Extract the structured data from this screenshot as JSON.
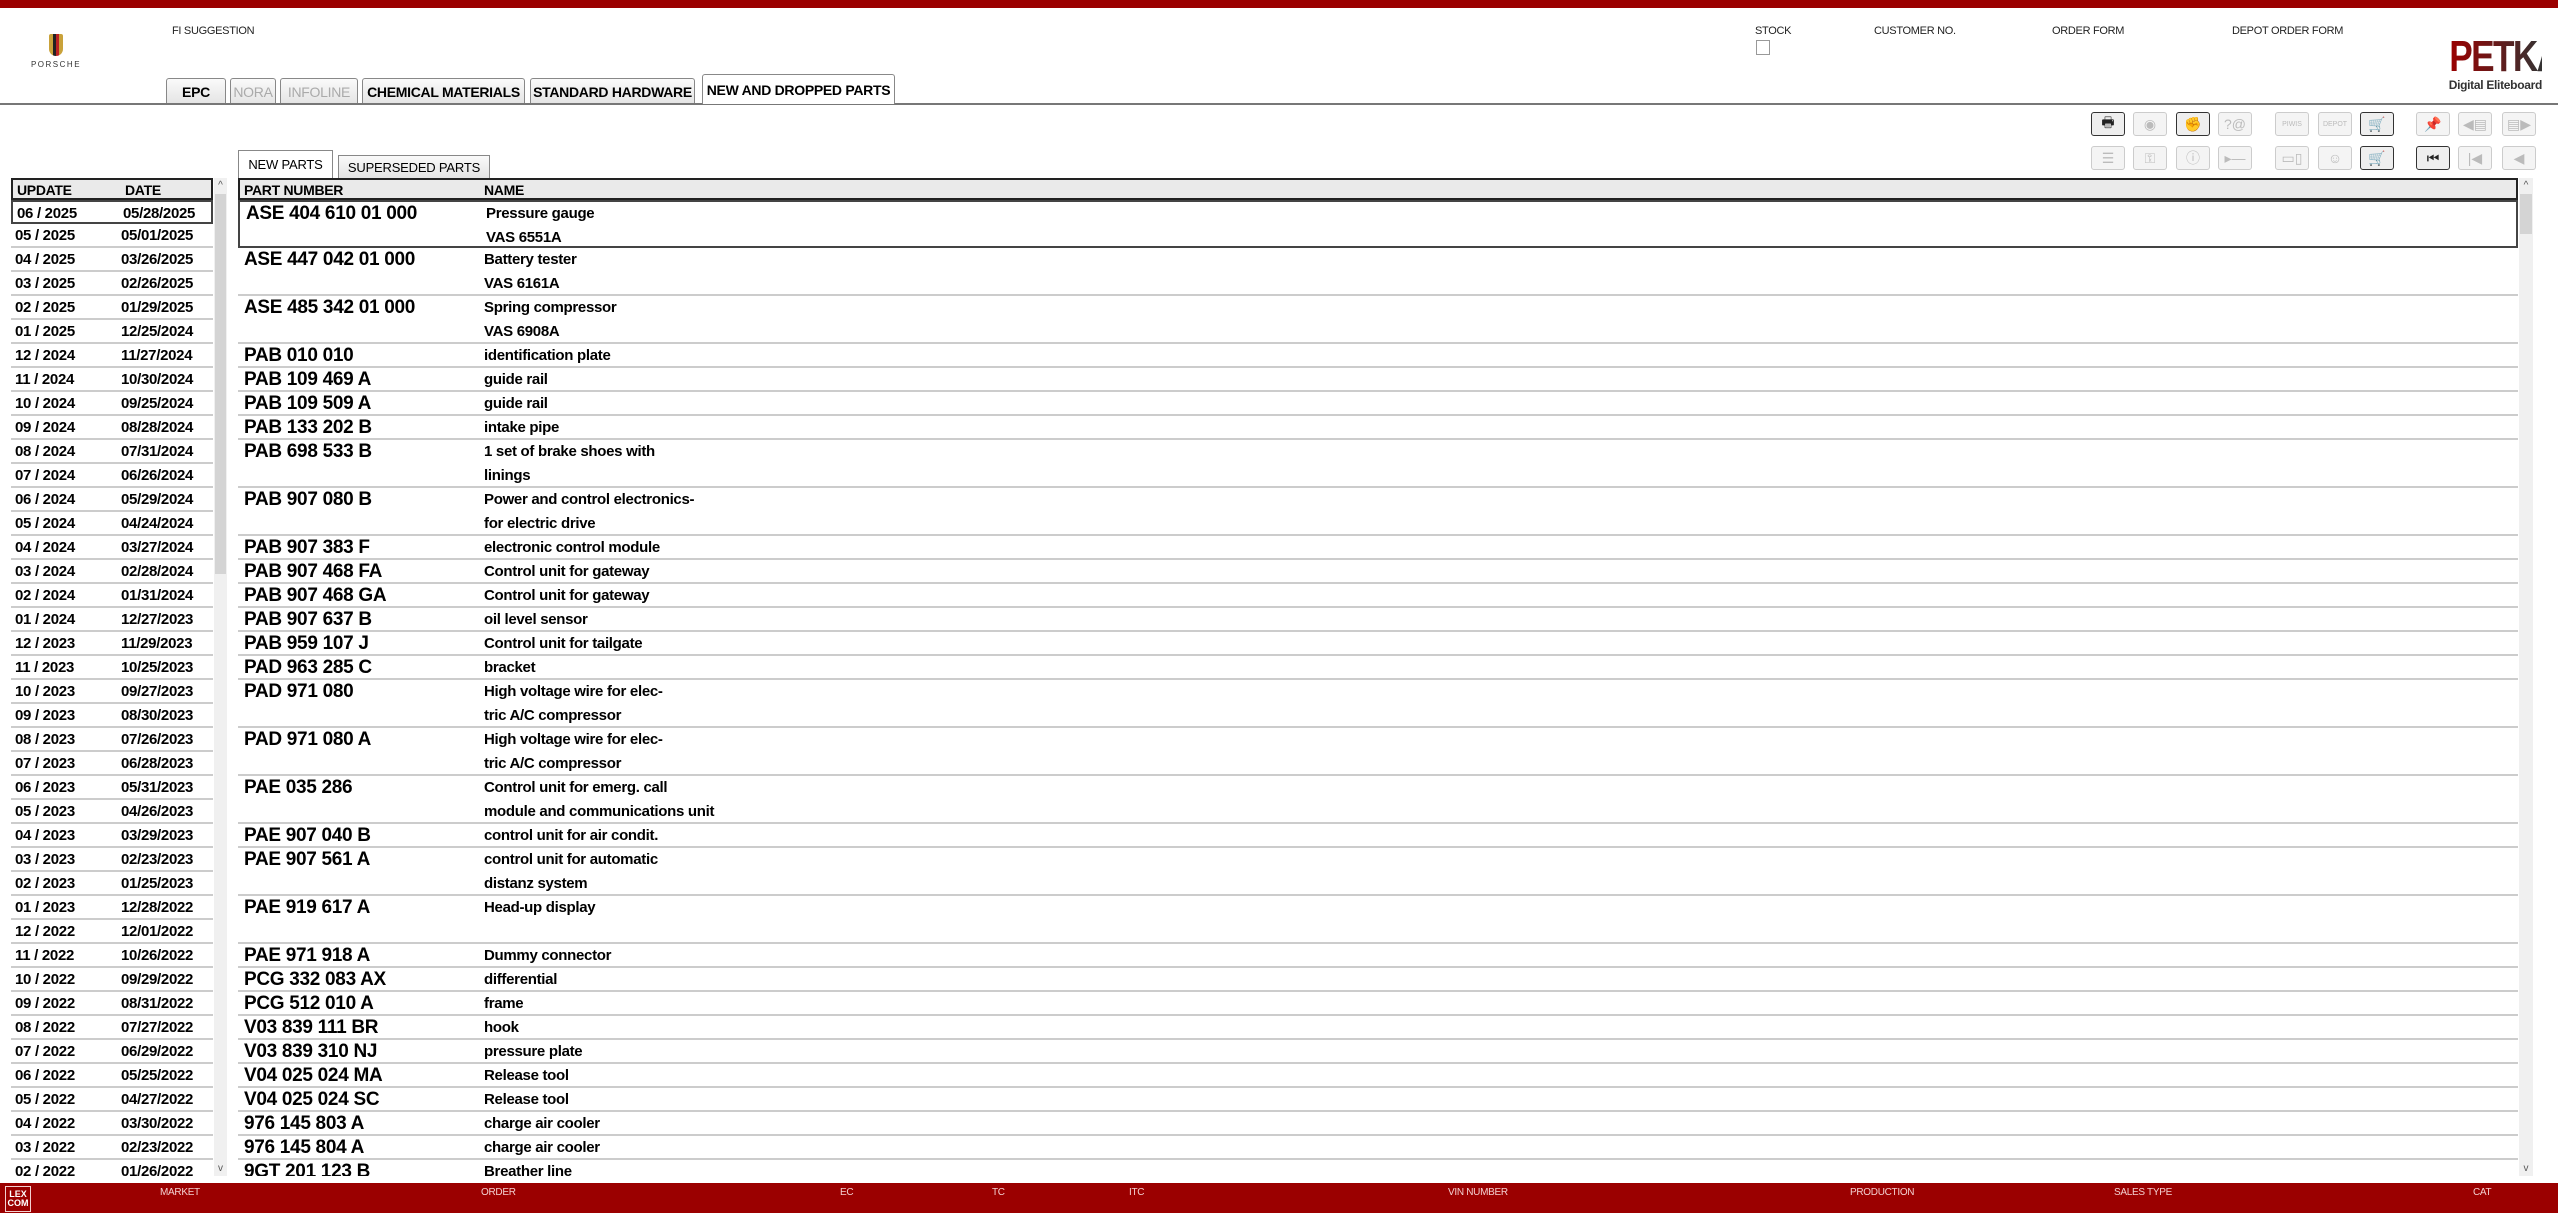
{
  "header": {
    "fi_suggestion": "FI SUGGESTION",
    "stock": "STOCK",
    "customer_no": "CUSTOMER NO.",
    "order_form": "ORDER FORM",
    "depot_order_form": "DEPOT ORDER FORM",
    "porsche_logo": "PORSCHE",
    "petka_logo": "PETKA",
    "petka_sub": "Digital Eliteboard"
  },
  "tabs": [
    "EPC",
    "NORA",
    "INFOLINE",
    "CHEMICAL MATERIALS",
    "STANDARD HARDWARE",
    "NEW AND DROPPED PARTS"
  ],
  "subtabs": [
    "NEW PARTS",
    "SUPERSEDED PARTS"
  ],
  "toolbar": {
    "piwis": "PIWIS",
    "depot": "DEPOT"
  },
  "left_list": {
    "headers": [
      "UPDATE",
      "DATE"
    ],
    "rows": [
      [
        "06 / 2025",
        "05/28/2025"
      ],
      [
        "05 / 2025",
        "05/01/2025"
      ],
      [
        "04 / 2025",
        "03/26/2025"
      ],
      [
        "03 / 2025",
        "02/26/2025"
      ],
      [
        "02 / 2025",
        "01/29/2025"
      ],
      [
        "01 / 2025",
        "12/25/2024"
      ],
      [
        "12 / 2024",
        "11/27/2024"
      ],
      [
        "11 / 2024",
        "10/30/2024"
      ],
      [
        "10 / 2024",
        "09/25/2024"
      ],
      [
        "09 / 2024",
        "08/28/2024"
      ],
      [
        "08 / 2024",
        "07/31/2024"
      ],
      [
        "07 / 2024",
        "06/26/2024"
      ],
      [
        "06 / 2024",
        "05/29/2024"
      ],
      [
        "05 / 2024",
        "04/24/2024"
      ],
      [
        "04 / 2024",
        "03/27/2024"
      ],
      [
        "03 / 2024",
        "02/28/2024"
      ],
      [
        "02 / 2024",
        "01/31/2024"
      ],
      [
        "01 / 2024",
        "12/27/2023"
      ],
      [
        "12 / 2023",
        "11/29/2023"
      ],
      [
        "11 / 2023",
        "10/25/2023"
      ],
      [
        "10 / 2023",
        "09/27/2023"
      ],
      [
        "09 / 2023",
        "08/30/2023"
      ],
      [
        "08 / 2023",
        "07/26/2023"
      ],
      [
        "07 / 2023",
        "06/28/2023"
      ],
      [
        "06 / 2023",
        "05/31/2023"
      ],
      [
        "05 / 2023",
        "04/26/2023"
      ],
      [
        "04 / 2023",
        "03/29/2023"
      ],
      [
        "03 / 2023",
        "02/23/2023"
      ],
      [
        "02 / 2023",
        "01/25/2023"
      ],
      [
        "01 / 2023",
        "12/28/2022"
      ],
      [
        "12 / 2022",
        "12/01/2022"
      ],
      [
        "11 / 2022",
        "10/26/2022"
      ],
      [
        "10 / 2022",
        "09/29/2022"
      ],
      [
        "09 / 2022",
        "08/31/2022"
      ],
      [
        "08 / 2022",
        "07/27/2022"
      ],
      [
        "07 / 2022",
        "06/29/2022"
      ],
      [
        "06 / 2022",
        "05/25/2022"
      ],
      [
        "05 / 2022",
        "04/27/2022"
      ],
      [
        "04 / 2022",
        "03/30/2022"
      ],
      [
        "03 / 2022",
        "02/23/2022"
      ],
      [
        "02 / 2022",
        "01/26/2022"
      ]
    ]
  },
  "parts": {
    "headers": [
      "PART NUMBER",
      "NAME"
    ],
    "rows": [
      {
        "pn": "ASE 404 610 01 000",
        "name": [
          "Pressure gauge",
          "VAS 6551A"
        ]
      },
      {
        "pn": "ASE 447 042 01 000",
        "name": [
          "Battery tester",
          "VAS 6161A"
        ]
      },
      {
        "pn": "ASE 485 342 01 000",
        "name": [
          "Spring compressor",
          "VAS 6908A"
        ]
      },
      {
        "pn": "PAB 010 010",
        "name": [
          "identification plate"
        ]
      },
      {
        "pn": "PAB 109 469 A",
        "name": [
          "guide rail"
        ]
      },
      {
        "pn": "PAB 109 509 A",
        "name": [
          "guide rail"
        ]
      },
      {
        "pn": "PAB 133 202 B",
        "name": [
          "intake pipe"
        ]
      },
      {
        "pn": "PAB 698 533 B",
        "name": [
          "1 set of brake shoes with",
          "linings"
        ]
      },
      {
        "pn": "PAB 907 080 B",
        "name": [
          "Power and control electronics-",
          "for electric drive"
        ]
      },
      {
        "pn": "PAB 907 383 F",
        "name": [
          "electronic control module"
        ]
      },
      {
        "pn": "PAB 907 468 FA",
        "name": [
          "Control unit for gateway"
        ]
      },
      {
        "pn": "PAB 907 468 GA",
        "name": [
          "Control unit for gateway"
        ]
      },
      {
        "pn": "PAB 907 637 B",
        "name": [
          "oil level sensor"
        ]
      },
      {
        "pn": "PAB 959 107 J",
        "name": [
          "Control unit for tailgate"
        ]
      },
      {
        "pn": "PAD 963 285 C",
        "name": [
          "bracket"
        ]
      },
      {
        "pn": "PAD 971 080",
        "name": [
          "High voltage wire for elec-",
          "tric A/C compressor"
        ]
      },
      {
        "pn": "PAD 971 080 A",
        "name": [
          "High voltage wire for elec-",
          "tric A/C compressor"
        ]
      },
      {
        "pn": "PAE 035 286",
        "name": [
          "Control unit for emerg. call",
          "module and communications unit"
        ]
      },
      {
        "pn": "PAE 907 040 B",
        "name": [
          "control unit for air condit."
        ]
      },
      {
        "pn": "PAE 907 561 A",
        "name": [
          "control unit for automatic",
          "distanz system"
        ]
      },
      {
        "pn": "PAE 919 617 A",
        "name": [
          "Head-up display",
          ""
        ]
      },
      {
        "pn": "PAE 971 918 A",
        "name": [
          "Dummy connector"
        ]
      },
      {
        "pn": "PCG 332 083 AX",
        "name": [
          "differential"
        ]
      },
      {
        "pn": "PCG 512 010 A",
        "name": [
          "frame"
        ]
      },
      {
        "pn": "V03 839 111 BR",
        "name": [
          "hook"
        ]
      },
      {
        "pn": "V03 839 310 NJ",
        "name": [
          "pressure plate"
        ]
      },
      {
        "pn": "V04 025 024 MA",
        "name": [
          "Release tool"
        ]
      },
      {
        "pn": "V04 025 024 SC",
        "name": [
          "Release tool"
        ]
      },
      {
        "pn": "976 145 803 A",
        "name": [
          "charge air cooler"
        ]
      },
      {
        "pn": "976 145 804 A",
        "name": [
          "charge air cooler"
        ]
      },
      {
        "pn": "9GT 201 123 B",
        "name": [
          "Breather line"
        ]
      }
    ]
  },
  "footer": {
    "lexcom": "LEX COM",
    "labels": [
      "MARKET",
      "ORDER",
      "EC",
      "TC",
      "ITC",
      "VIN NUMBER",
      "PRODUCTION",
      "SALES TYPE",
      "CAT"
    ]
  },
  "colors": {
    "brand_red": "#9b0000"
  }
}
